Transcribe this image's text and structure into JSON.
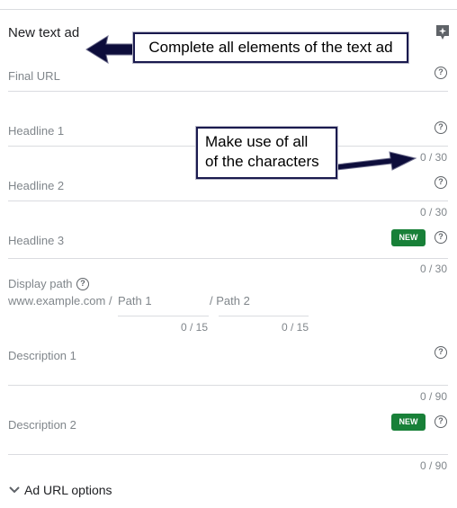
{
  "title": "New text ad",
  "fields": {
    "final_url": {
      "label": "Final URL"
    },
    "headline1": {
      "label": "Headline 1",
      "counter": "0 / 30"
    },
    "headline2": {
      "label": "Headline 2",
      "counter": "0 / 30"
    },
    "headline3": {
      "label": "Headline 3",
      "counter": "0 / 30",
      "badge": "NEW"
    },
    "display_path": {
      "label": "Display path",
      "prefix": "www.example.com /",
      "path1": {
        "label": "Path 1",
        "counter": "0 / 15"
      },
      "path2_label": "/ Path 2",
      "path2_counter": "0 / 15"
    },
    "description1": {
      "label": "Description 1",
      "counter": "0 / 90"
    },
    "description2": {
      "label": "Description 2",
      "counter": "0 / 90",
      "badge": "NEW"
    }
  },
  "help_glyph": "?",
  "ad_url_options": "Ad URL options",
  "callouts": {
    "complete": "Complete all elements of the text ad",
    "characters_line1": "Make use of all",
    "characters_line2": "of the characters"
  },
  "colors": {
    "badge": "#188038",
    "callout_border": "#1a1a4e",
    "arrow": "#0d0d3b"
  },
  "icons": [
    "preview-icon",
    "help-icon",
    "chevron-down-icon",
    "arrow-icon"
  ]
}
